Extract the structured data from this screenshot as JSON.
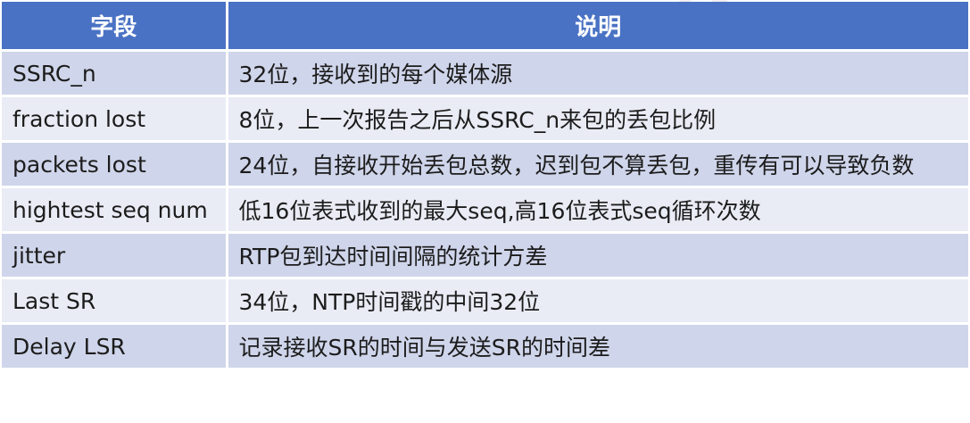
{
  "table": {
    "headers": [
      "字段",
      "说明"
    ],
    "rows": [
      {
        "field": "SSRC_n",
        "desc": "32位，接收到的每个媒体源"
      },
      {
        "field": "fraction lost",
        "desc": "8位，上一次报告之后从SSRC_n来包的丢包比例"
      },
      {
        "field": "packets lost",
        "desc": "24位，自接收开始丢包总数，迟到包不算丢包，重传有可以导致负数"
      },
      {
        "field": "hightest seq num",
        "desc": "低16位表式收到的最大seq,高16位表式seq循环次数"
      },
      {
        "field": "jitter",
        "desc": "RTP包到达时间间隔的统计方差"
      },
      {
        "field": "Last SR",
        "desc": "34位，NTP时间戳的中间32位"
      },
      {
        "field": "Delay LSR",
        "desc": "记录接收SR的时间与发送SR的时间差"
      }
    ]
  },
  "colors": {
    "header_bg": "#4a72c4",
    "row_odd_bg": "#cfd5ea",
    "row_even_bg": "#e9ecf5"
  }
}
